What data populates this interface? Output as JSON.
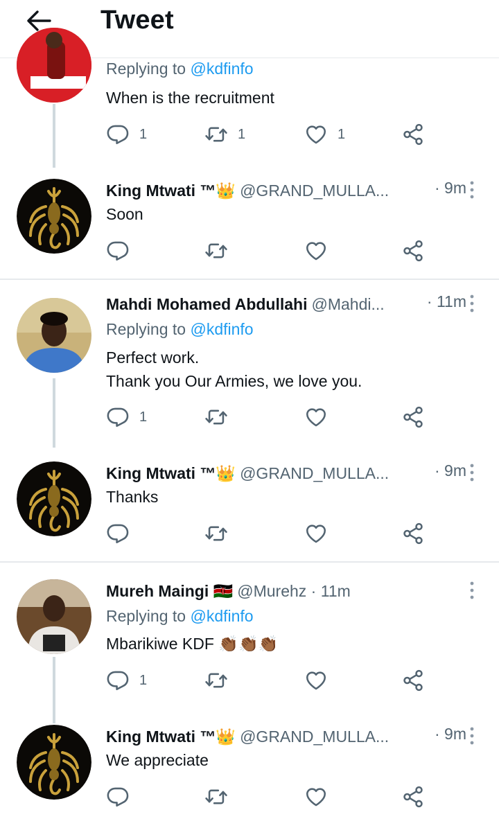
{
  "header": {
    "title": "Tweet"
  },
  "replying_prefix": "Replying to ",
  "tweets": [
    {
      "replying_to": "@kdfinfo",
      "text": "When is the recruitment",
      "reply_count": "1",
      "retweet_count": "1",
      "like_count": "1"
    },
    {
      "name": "King Mtwati ™👑",
      "handle": "@GRAND_MULLA...",
      "time": "· 9m",
      "text": "Soon",
      "reply_count": "",
      "retweet_count": "",
      "like_count": ""
    },
    {
      "name": "Mahdi Mohamed Abdullahi",
      "handle": "@Mahdi...",
      "time": "· 11m",
      "replying_to": "@kdfinfo",
      "text_line1": "Perfect work.",
      "text_line2": "Thank you Our Armies, we love you.",
      "reply_count": "1",
      "retweet_count": "",
      "like_count": ""
    },
    {
      "name": "King Mtwati ™👑",
      "handle": "@GRAND_MULLA...",
      "time": "· 9m",
      "text": "Thanks",
      "reply_count": "",
      "retweet_count": "",
      "like_count": ""
    },
    {
      "name": "Mureh Maingi 🇰🇪",
      "handle": "@Murehz · 11m",
      "replying_to": "@kdfinfo",
      "text": "Mbarikiwe KDF 👏🏾👏🏾👏🏾",
      "reply_count": "1",
      "retweet_count": "",
      "like_count": ""
    },
    {
      "name": "King Mtwati ™👑",
      "handle": "@GRAND_MULLA...",
      "time": "· 9m",
      "text": "We appreciate",
      "reply_count": "",
      "retweet_count": "",
      "like_count": ""
    }
  ],
  "colors": {
    "link": "#1d9bf0",
    "secondary_text": "#536471",
    "thread_line": "#cfd9de"
  },
  "icons": [
    "back-arrow-icon",
    "reply-icon",
    "retweet-icon",
    "like-icon",
    "share-icon",
    "more-icon"
  ]
}
